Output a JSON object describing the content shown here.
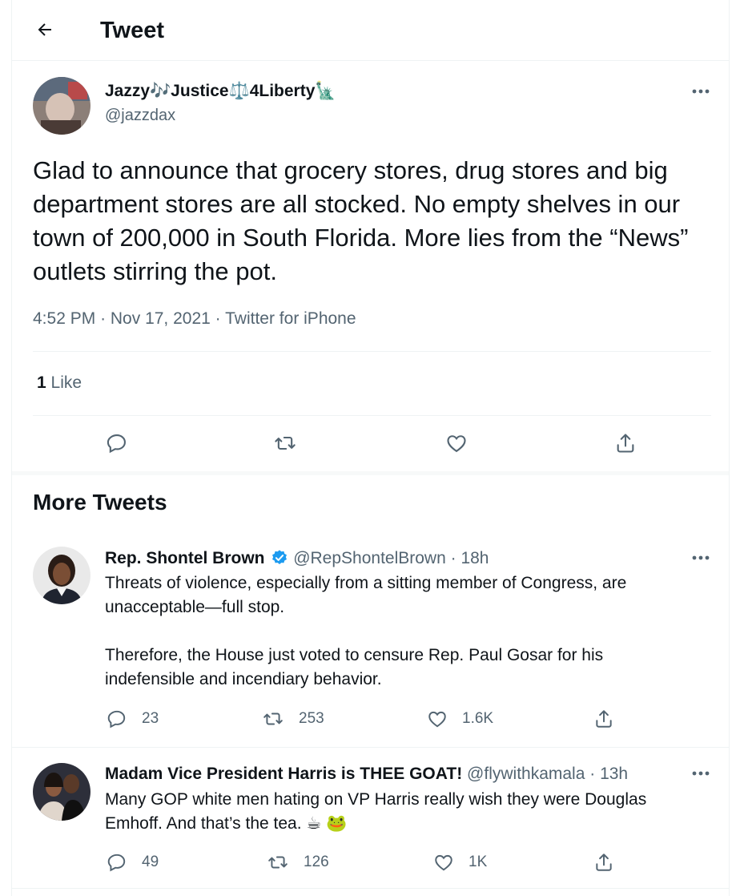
{
  "header": {
    "title": "Tweet"
  },
  "tweet": {
    "author_name": "Jazzy🎶Justice⚖️4Liberty🗽",
    "author_handle": "@jazzdax",
    "text": "Glad to announce that grocery stores, drug stores and big department stores are all stocked. No empty shelves in our town of 200,000 in South Florida. More lies from the “News” outlets stirring the pot.",
    "time": "4:52 PM",
    "date": "Nov 17, 2021",
    "source": "Twitter for iPhone",
    "like_count": "1",
    "like_label": "Like"
  },
  "more_tweets": {
    "title": "More Tweets",
    "items": [
      {
        "name": "Rep. Shontel Brown",
        "verified": true,
        "handle": "@RepShontelBrown",
        "time": "18h",
        "text": "Threats of violence, especially from a sitting member of Congress, are unacceptable—full stop.\n\nTherefore, the House just voted to censure Rep. Paul Gosar for his indefensible and incendiary behavior.",
        "replies": "23",
        "retweets": "253",
        "likes": "1.6K"
      },
      {
        "name": "Madam Vice President Harris is THEE GOAT!",
        "verified": false,
        "handle": "@flywithkamala",
        "time": "13h",
        "text": "Many GOP white men hating on VP Harris really wish they were Douglas Emhoff. And that’s the tea. ☕ 🐸",
        "replies": "49",
        "retweets": "126",
        "likes": "1K"
      }
    ]
  },
  "colors": {
    "text": "#0f1419",
    "secondary": "#536471",
    "border": "#eff3f4",
    "verified": "#1d9bf0"
  }
}
